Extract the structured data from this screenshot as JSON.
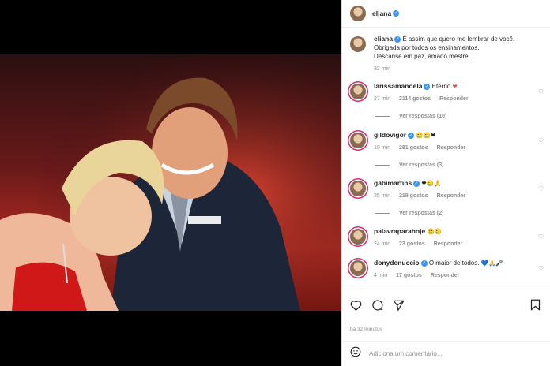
{
  "post": {
    "author": "eliana",
    "caption_line1": "É assim que quero me lembrar de você.",
    "caption_line2": "Obrigada por todos os ensinamentos.",
    "caption_line3": "Descanse em paz, amado mestre.",
    "caption_age": "32 min",
    "time_ago": "há 32 minutos",
    "add_comment_placeholder": "Adiciona um comentário..."
  },
  "comments": [
    {
      "user": "larissamanoela",
      "text": "Eterno",
      "emoji": "❤",
      "age": "27 min",
      "likes": "2114 gostos",
      "reply": "Responder",
      "view_replies": "Ver respostas (10)"
    },
    {
      "user": "gildovigor",
      "text": "",
      "emoji": "🥲🥲❤",
      "age": "19 min",
      "likes": "281 gostos",
      "reply": "Responder",
      "view_replies": "Ver respostas (3)"
    },
    {
      "user": "gabimartins",
      "text": "",
      "emoji": "❤🥲🙏",
      "age": "25 min",
      "likes": "219 gostos",
      "reply": "Responder",
      "view_replies": "Ver respostas (2)"
    },
    {
      "user": "palavraparahoje",
      "text": "",
      "emoji": "🥲🥲",
      "age": "24 min",
      "likes": "23 gostos",
      "reply": "Responder",
      "view_replies": ""
    },
    {
      "user": "donydenuccio",
      "text": "O maior de todos.",
      "emoji": "💙🙏🎤",
      "age": "4 min",
      "likes": "17 gostos",
      "reply": "Responder",
      "view_replies": ""
    }
  ],
  "icons": {
    "like": "heart-icon",
    "comment": "comment-icon",
    "share": "share-icon",
    "save": "bookmark-icon",
    "emoji": "emoji-icon",
    "verified": "verified-badge-icon"
  },
  "colors": {
    "verified": "#3897f0",
    "heart": "#ed4956",
    "story_ring": "#d62976"
  }
}
